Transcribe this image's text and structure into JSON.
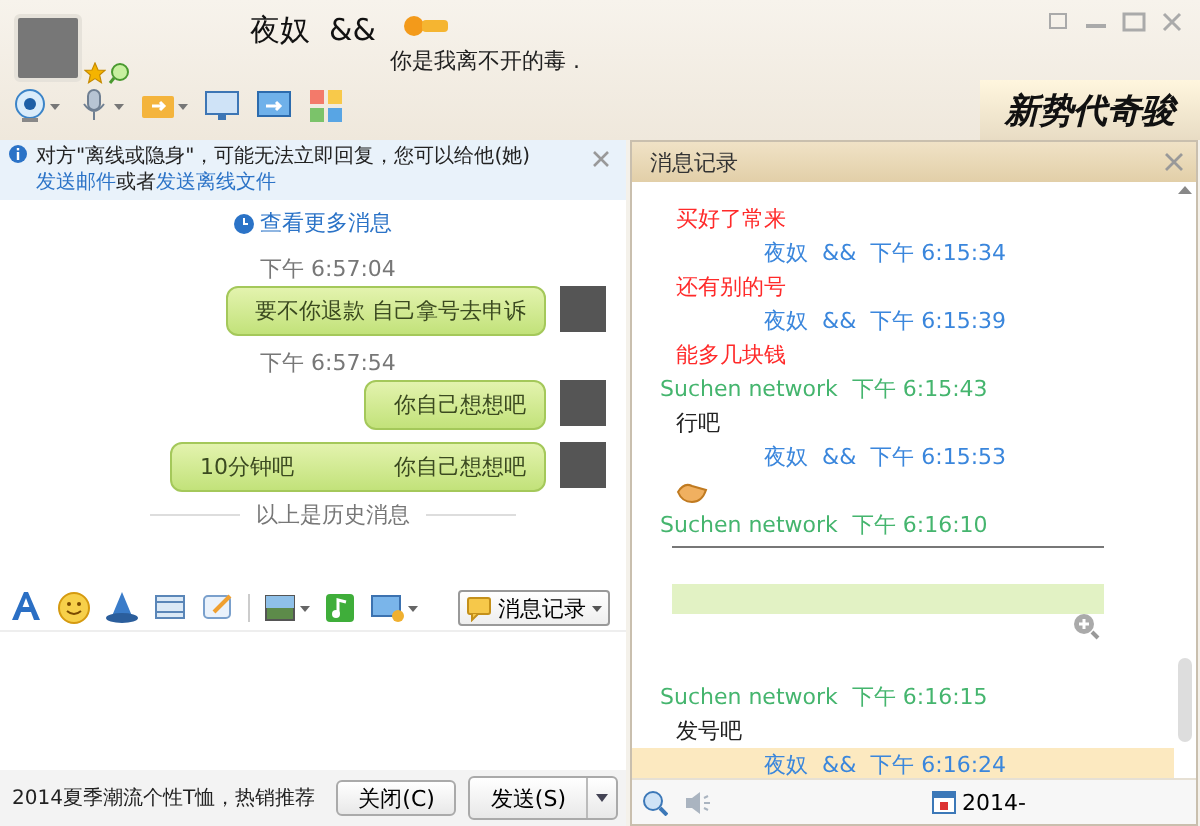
{
  "contact": {
    "name": "夜奴  &&",
    "status": "你是我离不开的毒 ."
  },
  "ad_banner": {
    "text": "新势代奇骏"
  },
  "notice": {
    "segments": [
      {
        "kind": "text",
        "text": "对方\"离线或隐身\"，可能无法立即回复，您可以给他(她)"
      },
      {
        "kind": "link",
        "text": "发送邮件"
      },
      {
        "kind": "text",
        "text": "或者"
      },
      {
        "kind": "link",
        "text": "发送离线文件"
      }
    ]
  },
  "chat": {
    "more_link": "查看更多消息",
    "messages": [
      {
        "kind": "time",
        "text": "下午 6:57:04"
      },
      {
        "kind": "bubble",
        "parts": [
          "要不你退款 自己拿号去申诉"
        ]
      },
      {
        "kind": "time",
        "text": "下午 6:57:54"
      },
      {
        "kind": "bubble",
        "parts": [
          "你自己想想吧"
        ]
      },
      {
        "kind": "bubble",
        "parts": [
          "10分钟吧",
          "你自己想想吧"
        ]
      }
    ],
    "history_divider": "以上是历史消息"
  },
  "toolbar": {
    "history_button": "消息记录"
  },
  "footer": {
    "ad": "2014夏季潮流个性T恤，热销推荐",
    "buttons": [
      "关闭(C)",
      "发送(S)"
    ]
  },
  "history": {
    "title": "消息记录",
    "entries": [
      {
        "kind": "message",
        "text": "买好了常来",
        "color": "#ff2a2a",
        "selected": false
      },
      {
        "kind": "sender",
        "name": "夜奴  &&",
        "time": "下午 6:15:34",
        "color": "#3a86dc",
        "selected": false
      },
      {
        "kind": "message",
        "text": "还有别的号",
        "color": "#ff2a2a",
        "selected": false
      },
      {
        "kind": "sender",
        "name": "夜奴  &&",
        "time": "下午 6:15:39",
        "color": "#3a86dc",
        "selected": false
      },
      {
        "kind": "message",
        "text": "能多几块钱",
        "color": "#ff2a2a",
        "selected": false
      },
      {
        "kind": "sender",
        "name": "Suchen network",
        "time": "下午 6:15:43",
        "color": "#45b56e",
        "selected": false
      },
      {
        "kind": "message",
        "text": "行吧",
        "color": "#222222",
        "selected": false
      },
      {
        "kind": "sender",
        "name": "夜奴  &&",
        "time": "下午 6:15:53",
        "color": "#3a86dc",
        "selected": false
      },
      {
        "kind": "emoji",
        "selected": false
      },
      {
        "kind": "sender",
        "name": "Suchen network",
        "time": "下午 6:16:10",
        "color": "#45b56e",
        "selected": false
      },
      {
        "kind": "image",
        "selected": false
      },
      {
        "kind": "sender",
        "name": "Suchen network",
        "time": "下午 6:16:15",
        "color": "#45b56e",
        "selected": false
      },
      {
        "kind": "message",
        "text": "发号吧",
        "color": "#222222",
        "selected": false
      },
      {
        "kind": "sender",
        "name": "夜奴  &&",
        "time": "下午 6:16:24",
        "color": "#3a86dc",
        "selected": true
      }
    ],
    "date": "2014-"
  }
}
